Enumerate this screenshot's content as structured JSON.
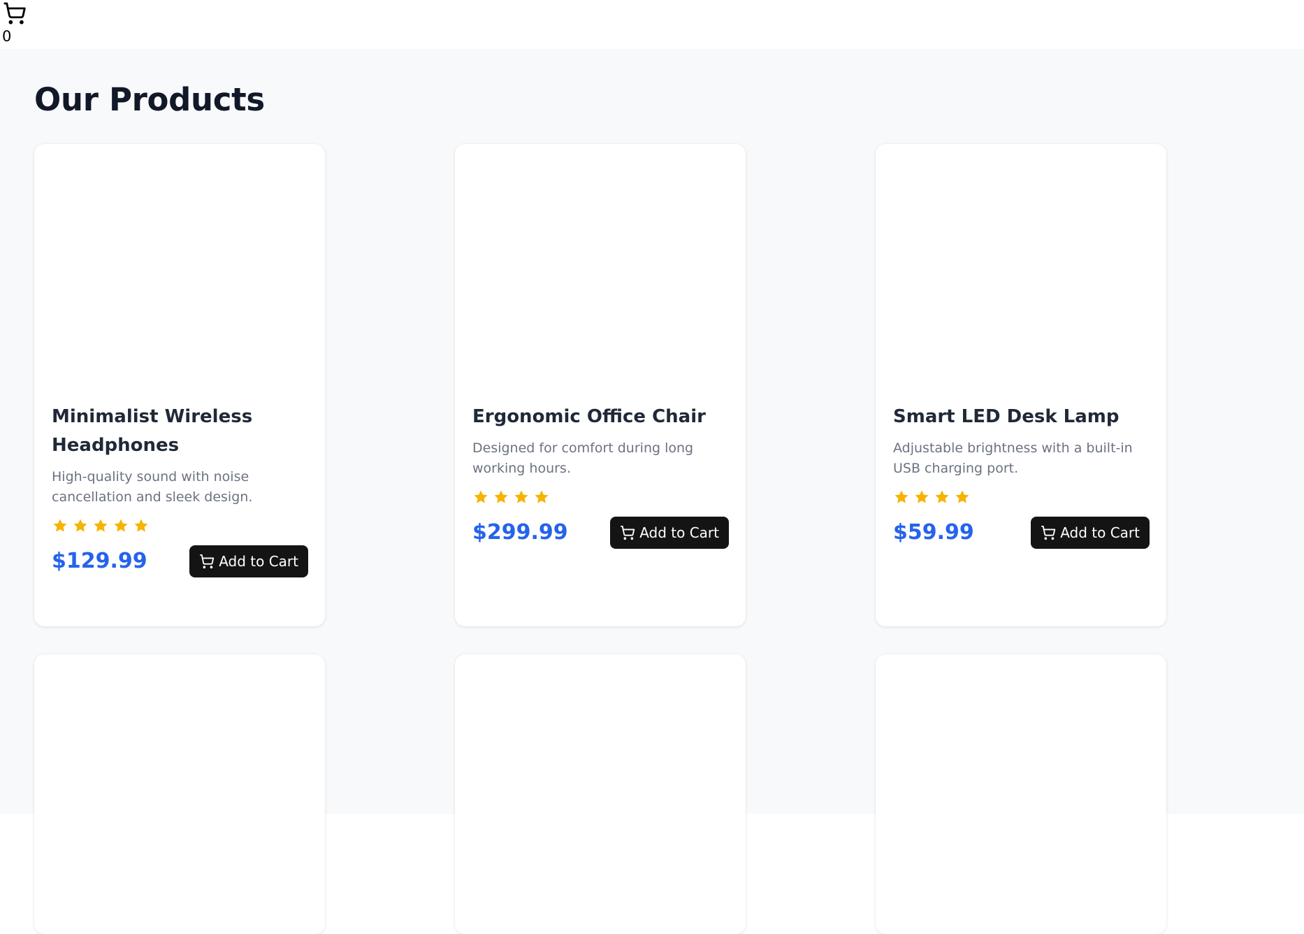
{
  "header": {
    "cart_icon": "shopping-cart-icon",
    "cart_count": "0"
  },
  "page": {
    "title": "Our Products"
  },
  "colors": {
    "price": "#2563eb",
    "star": "#f5b400",
    "button_bg": "#141414",
    "page_bg": "#f8f9fb"
  },
  "products": [
    {
      "name": "Minimalist Wireless Headphones",
      "description": "High-quality sound with noise cancellation and sleek design.",
      "rating": 5,
      "price": "$129.99",
      "button_label": "Add to Cart"
    },
    {
      "name": "Ergonomic Office Chair",
      "description": "Designed for comfort during long working hours.",
      "rating": 4,
      "price": "$299.99",
      "button_label": "Add to Cart"
    },
    {
      "name": "Smart LED Desk Lamp",
      "description": "Adjustable brightness with a built-in USB charging port.",
      "rating": 4,
      "price": "$59.99",
      "button_label": "Add to Cart"
    }
  ]
}
